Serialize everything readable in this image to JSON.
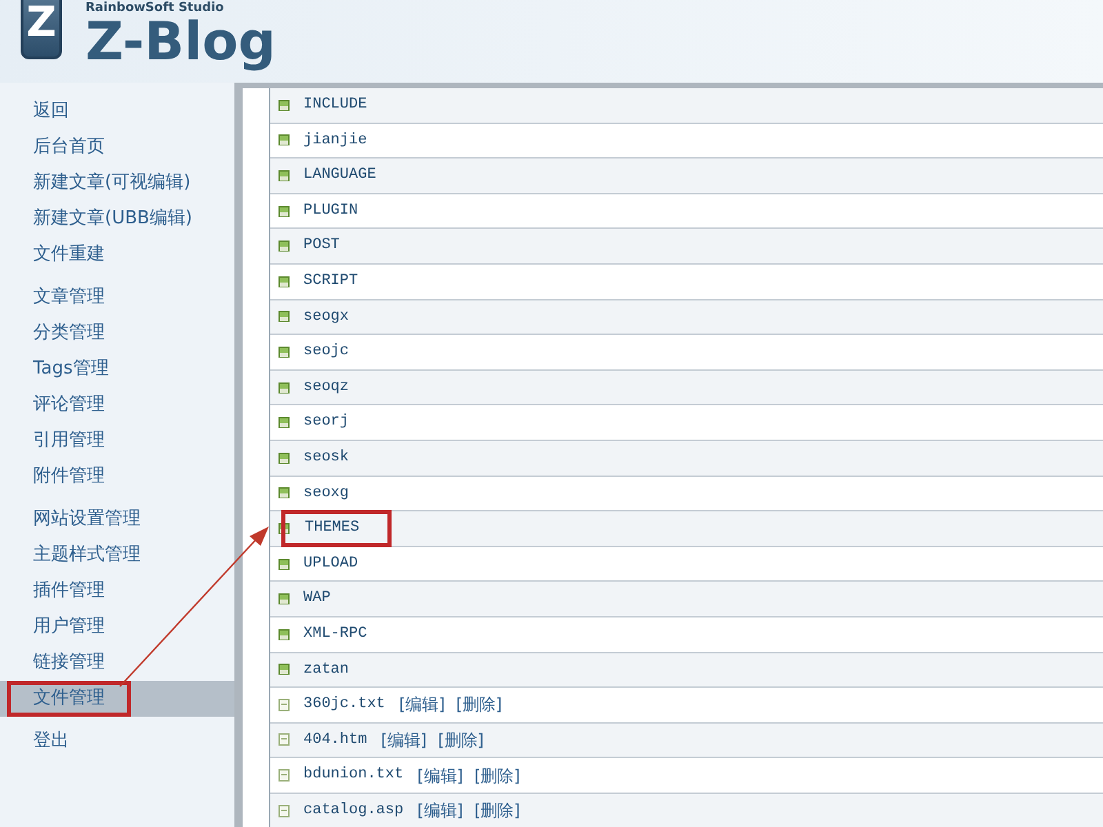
{
  "header": {
    "studio": "RainbowSoft Studio",
    "logo_letter": "Z",
    "title": "Z-Blog"
  },
  "sidebar": {
    "groups": [
      [
        {
          "label": "返回",
          "selected": false
        },
        {
          "label": "后台首页",
          "selected": false
        },
        {
          "label": "新建文章(可视编辑)",
          "selected": false
        },
        {
          "label": "新建文章(UBB编辑)",
          "selected": false
        },
        {
          "label": "文件重建",
          "selected": false
        }
      ],
      [
        {
          "label": "文章管理",
          "selected": false
        },
        {
          "label": "分类管理",
          "selected": false
        },
        {
          "label": "Tags管理",
          "selected": false
        },
        {
          "label": "评论管理",
          "selected": false
        },
        {
          "label": "引用管理",
          "selected": false
        },
        {
          "label": "附件管理",
          "selected": false
        }
      ],
      [
        {
          "label": "网站设置管理",
          "selected": false
        },
        {
          "label": "主题样式管理",
          "selected": false
        },
        {
          "label": "插件管理",
          "selected": false
        },
        {
          "label": "用户管理",
          "selected": false
        },
        {
          "label": "链接管理",
          "selected": false
        },
        {
          "label": "文件管理",
          "selected": true,
          "highlighted": true
        }
      ],
      [
        {
          "label": "登出",
          "selected": false
        }
      ]
    ]
  },
  "files": [
    {
      "kind": "folder",
      "name": "INCLUDE"
    },
    {
      "kind": "folder",
      "name": "jianjie"
    },
    {
      "kind": "folder",
      "name": "LANGUAGE"
    },
    {
      "kind": "folder",
      "name": "PLUGIN"
    },
    {
      "kind": "folder",
      "name": "POST"
    },
    {
      "kind": "folder",
      "name": "SCRIPT"
    },
    {
      "kind": "folder",
      "name": "seogx"
    },
    {
      "kind": "folder",
      "name": "seojc"
    },
    {
      "kind": "folder",
      "name": "seoqz"
    },
    {
      "kind": "folder",
      "name": "seorj"
    },
    {
      "kind": "folder",
      "name": "seosk"
    },
    {
      "kind": "folder",
      "name": "seoxg"
    },
    {
      "kind": "folder",
      "name": "THEMES",
      "highlighted": true
    },
    {
      "kind": "folder",
      "name": "UPLOAD"
    },
    {
      "kind": "folder",
      "name": "WAP"
    },
    {
      "kind": "folder",
      "name": "XML-RPC"
    },
    {
      "kind": "folder",
      "name": "zatan"
    },
    {
      "kind": "file",
      "name": "360jc.txt",
      "actions": [
        "[编辑]",
        "[删除]"
      ]
    },
    {
      "kind": "file",
      "name": "404.htm",
      "actions": [
        "[编辑]",
        "[删除]"
      ]
    },
    {
      "kind": "file",
      "name": "bdunion.txt",
      "actions": [
        "[编辑]",
        "[删除]"
      ]
    },
    {
      "kind": "file",
      "name": "catalog.asp",
      "actions": [
        "[编辑]",
        "[删除]"
      ]
    }
  ]
}
